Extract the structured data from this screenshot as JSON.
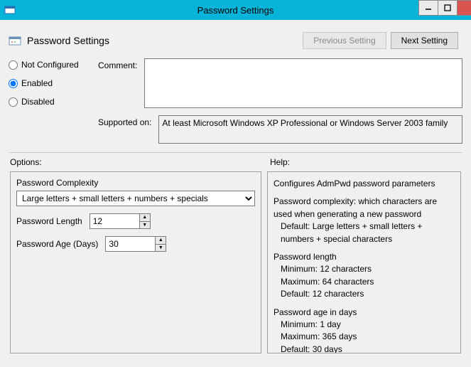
{
  "window": {
    "title": "Password Settings"
  },
  "header": {
    "title": "Password Settings",
    "prev_label": "Previous Setting",
    "next_label": "Next Setting"
  },
  "state": {
    "not_configured": "Not Configured",
    "enabled": "Enabled",
    "disabled": "Disabled",
    "selected": "enabled",
    "comment_label": "Comment:",
    "comment_value": "",
    "supported_label": "Supported on:",
    "supported_value": "At least Microsoft Windows XP Professional or Windows Server 2003 family"
  },
  "sections": {
    "options_label": "Options:",
    "help_label": "Help:"
  },
  "options": {
    "complexity": {
      "label": "Password Complexity",
      "value": "Large letters + small letters + numbers + specials"
    },
    "length": {
      "label": "Password Length",
      "value": "12"
    },
    "age": {
      "label": "Password Age (Days)   ",
      "value": "30"
    }
  },
  "help": {
    "line1": "Configures AdmPwd password parameters",
    "line2a": "Password complexity: which characters are used when generating a new password",
    "line2b": "Default: Large letters + small letters + numbers + special characters",
    "line3": "Password length",
    "line3a": "Minimum: 12 characters",
    "line3b": "Maximum: 64 characters",
    "line3c": "Default: 12 characters",
    "line4": "Password age in days",
    "line4a": "Minimum: 1 day",
    "line4b": "Maximum: 365 days",
    "line4c": "Default: 30 days"
  }
}
